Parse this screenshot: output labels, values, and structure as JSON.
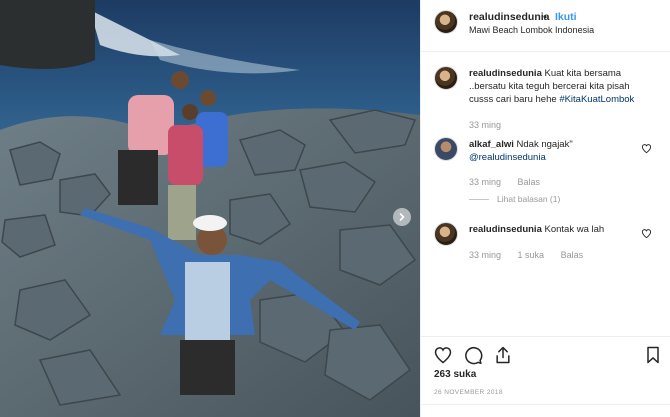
{
  "header": {
    "username": "realudinsedunia",
    "separator": "•",
    "follow_label": "Ikuti",
    "location": "Mawi Beach Lombok Indonesia"
  },
  "caption": {
    "username": "realudinsedunia",
    "text": "Kuat kita bersama ..bersatu kita teguh bercerai kita pisah cusss cari baru hehe",
    "hashtag": "#KitaKuatLombok",
    "time": "33 ming"
  },
  "comments": [
    {
      "username": "alkaf_alwi",
      "text": "Ndak ngajak\"",
      "mention": "@realudinsedunia",
      "time": "33 ming",
      "reply_label": "Balas",
      "view_replies": "Lihat balasan (1)"
    },
    {
      "username": "realudinsedunia",
      "text": "Kontak wa lah",
      "time": "33 ming",
      "likes": "1 suka",
      "reply_label": "Balas"
    }
  ],
  "footer": {
    "likes": "263 suka",
    "date": "26 NOVEMBER 2018"
  },
  "icons": {
    "like": "heart-icon",
    "comment": "comment-icon",
    "share": "share-icon",
    "save": "bookmark-icon",
    "next": "chevron-right-icon"
  },
  "colors": {
    "link": "#3897f0",
    "hashtag": "#003569",
    "muted": "#999999"
  }
}
